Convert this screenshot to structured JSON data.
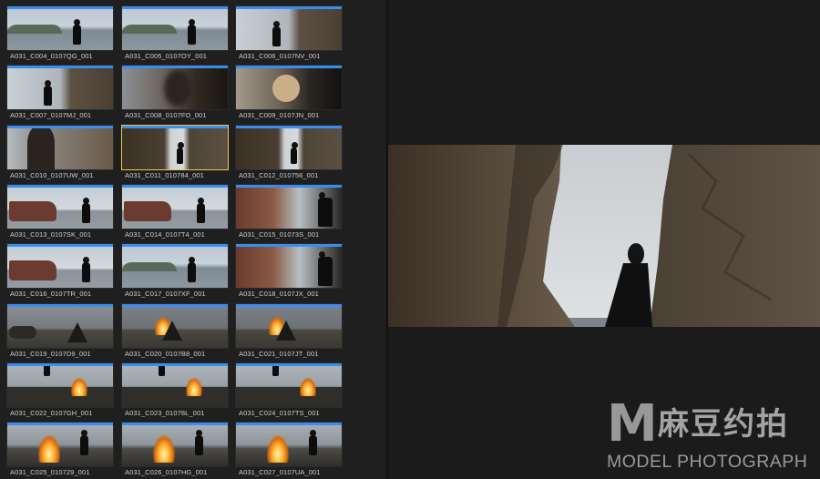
{
  "browser": {
    "clips": [
      {
        "name": "A031_C004_0107QG_001",
        "scene": "coast"
      },
      {
        "name": "A031_C005_0107OY_001",
        "scene": "coast"
      },
      {
        "name": "A031_C006_0107NV_001",
        "scene": "rock-right"
      },
      {
        "name": "A031_C007_0107MJ_001",
        "scene": "rock-right"
      },
      {
        "name": "A031_C008_0107FO_001",
        "scene": "blur"
      },
      {
        "name": "A031_C009_0107JN_001",
        "scene": "guitar-close"
      },
      {
        "name": "A031_C010_0107UW_001",
        "scene": "closeup"
      },
      {
        "name": "A031_C011_010784_001",
        "scene": "gap",
        "selected": true
      },
      {
        "name": "A031_C012_010756_001",
        "scene": "gap"
      },
      {
        "name": "A031_C013_0107SK_001",
        "scene": "ship"
      },
      {
        "name": "A031_C014_0107T4_001",
        "scene": "ship"
      },
      {
        "name": "A031_C015_01073S_001",
        "scene": "ship-close"
      },
      {
        "name": "A031_C016_0107TR_001",
        "scene": "ship"
      },
      {
        "name": "A031_C017_0107XF_001",
        "scene": "coast"
      },
      {
        "name": "A031_C018_0107JX_001",
        "scene": "ship-close"
      },
      {
        "name": "A031_C019_0107D9_001",
        "scene": "tent"
      },
      {
        "name": "A031_C020_0107B8_001",
        "scene": "tent-fire"
      },
      {
        "name": "A031_C021_0107JT_001",
        "scene": "tent-fire"
      },
      {
        "name": "A031_C022_0107GH_001",
        "scene": "fire"
      },
      {
        "name": "A031_C023_01078L_001",
        "scene": "fire"
      },
      {
        "name": "A031_C024_0107TS_001",
        "scene": "fire"
      },
      {
        "name": "A031_C025_010729_001",
        "scene": "fire-big"
      },
      {
        "name": "A031_C026_0107HG_001",
        "scene": "fire-big"
      },
      {
        "name": "A031_C027_0107UA_001",
        "scene": "fire-big"
      }
    ]
  },
  "watermark": {
    "logo_letter": "M",
    "cn_text": "麻豆约拍",
    "en_text": "MODEL PHOTOGRAPH"
  },
  "colors": {
    "selection": "#f4c542",
    "audio_bar": "#3a8df0",
    "background": "#1f1f1f"
  }
}
